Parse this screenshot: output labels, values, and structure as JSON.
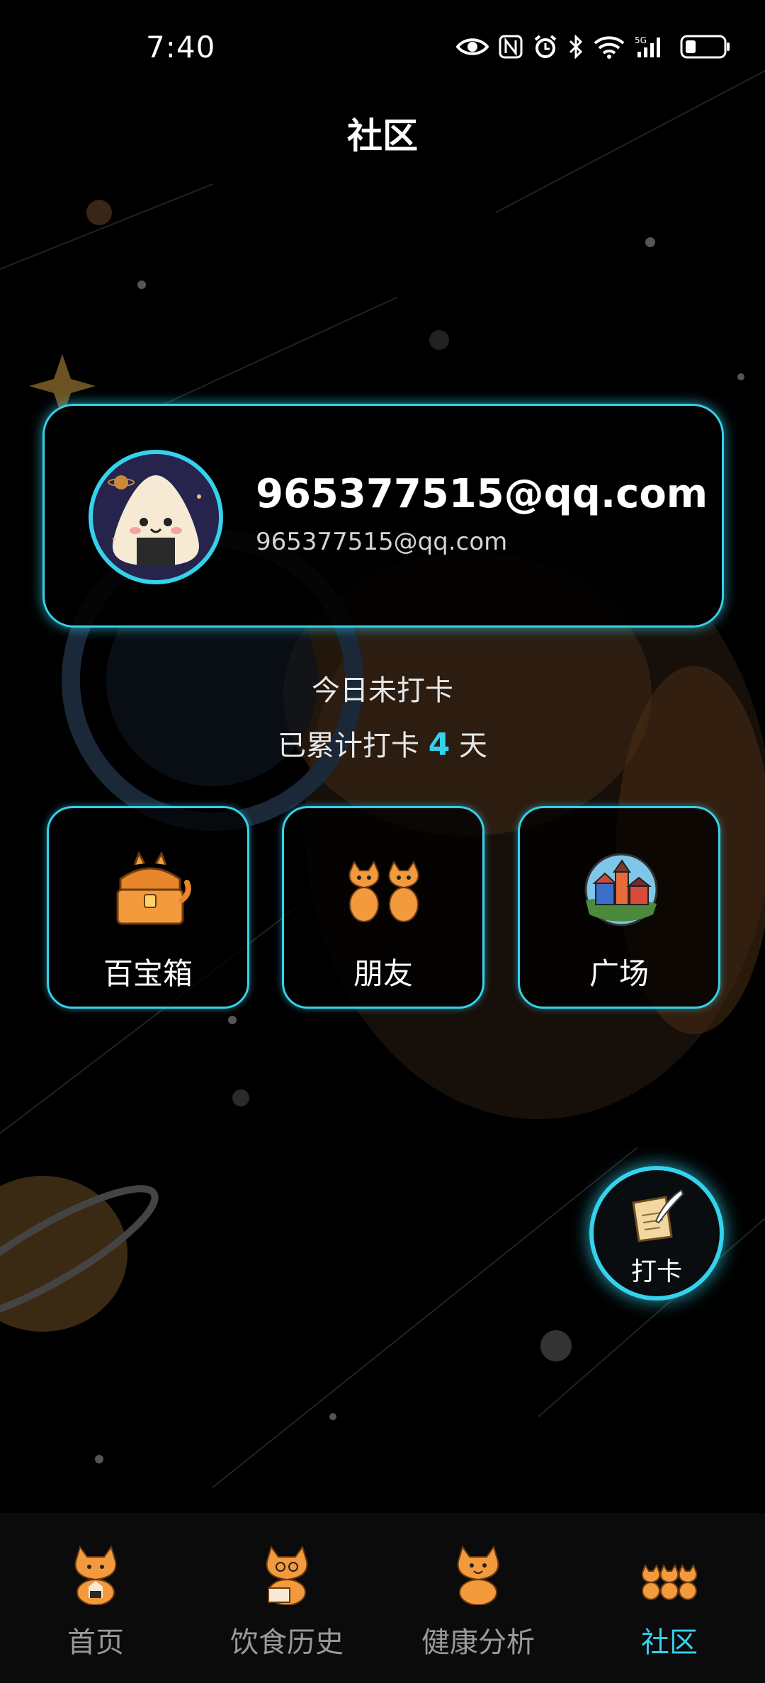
{
  "status_bar": {
    "time": "7:40",
    "icons": [
      "eye-icon",
      "nfc-icon",
      "alarm-icon",
      "bluetooth-icon",
      "wifi-icon",
      "signal-5g-icon",
      "battery-icon"
    ]
  },
  "header": {
    "title": "社区"
  },
  "profile": {
    "name": "965377515@qq.com",
    "email": "965377515@qq.com",
    "avatar_icon": "rice-ball-avatar-icon"
  },
  "checkin": {
    "today_status": "今日未打卡",
    "total_prefix": "已累计打卡",
    "total_days": "4",
    "total_suffix": "天"
  },
  "tiles": [
    {
      "label": "百宝箱",
      "icon": "treasure-chest-icon"
    },
    {
      "label": "朋友",
      "icon": "cat-friends-icon"
    },
    {
      "label": "广场",
      "icon": "town-square-icon"
    }
  ],
  "fab": {
    "label": "打卡",
    "icon": "quill-paper-icon"
  },
  "bottom_nav": [
    {
      "label": "首页",
      "icon": "cat-home-icon",
      "active": false
    },
    {
      "label": "饮食历史",
      "icon": "cat-history-icon",
      "active": false
    },
    {
      "label": "健康分析",
      "icon": "cat-analysis-icon",
      "active": false
    },
    {
      "label": "社区",
      "icon": "cat-community-icon",
      "active": true
    }
  ],
  "colors": {
    "accent": "#35d2ec",
    "background": "#000000",
    "cat_orange": "#f29a3c"
  }
}
